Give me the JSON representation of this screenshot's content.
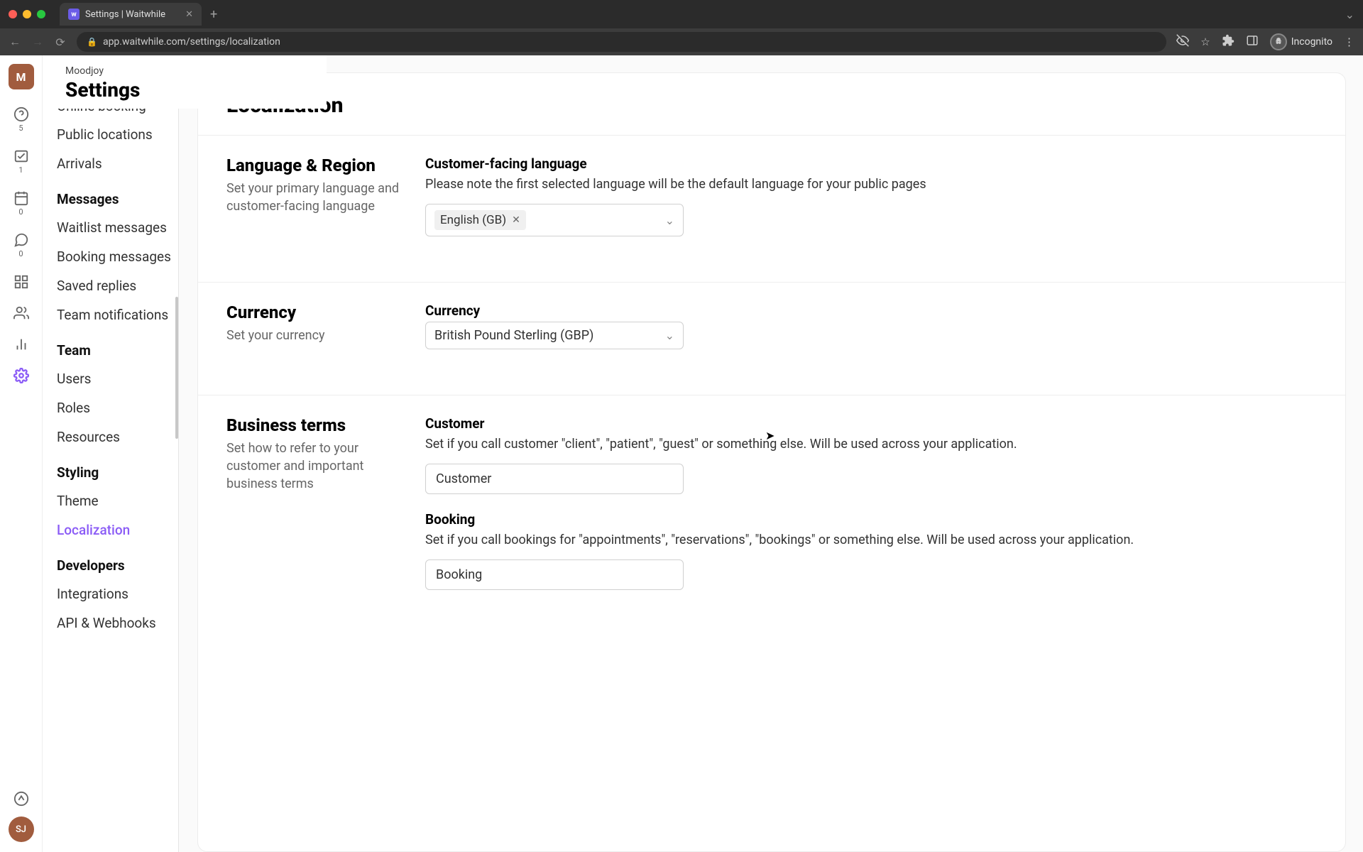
{
  "browser": {
    "tab_title": "Settings | Waitwhile",
    "url": "app.waitwhile.com/settings/localization",
    "incognito_label": "Incognito"
  },
  "rail": {
    "logo_letter": "M",
    "badges": {
      "help": "5",
      "inbox": "1",
      "calendar": "0",
      "chat": "0"
    },
    "avatar_initials": "SJ"
  },
  "header": {
    "breadcrumb": "Moodjoy",
    "title": "Settings"
  },
  "sidebar": {
    "cut_item": "Online booking",
    "items_top": [
      "Public locations",
      "Arrivals"
    ],
    "group_messages": "Messages",
    "items_messages": [
      "Waitlist messages",
      "Booking messages",
      "Saved replies",
      "Team notifications"
    ],
    "group_team": "Team",
    "items_team": [
      "Users",
      "Roles",
      "Resources"
    ],
    "group_styling": "Styling",
    "items_styling": [
      "Theme",
      "Localization"
    ],
    "group_developers": "Developers",
    "items_developers": [
      "Integrations",
      "API & Webhooks"
    ]
  },
  "main": {
    "title": "Localization",
    "language": {
      "section_title": "Language & Region",
      "section_desc": "Set your primary language and customer-facing language",
      "field_label": "Customer-facing language",
      "field_desc": "Please note the first selected language will be the default language for your public pages",
      "chip_value": "English (GB)"
    },
    "currency": {
      "section_title": "Currency",
      "section_desc": "Set your currency",
      "field_label": "Currency",
      "select_value": "British Pound Sterling (GBP)"
    },
    "terms": {
      "section_title": "Business terms",
      "section_desc": "Set how to refer to your customer and important business terms",
      "customer_label": "Customer",
      "customer_desc": "Set if you call customer \"client\", \"patient\", \"guest\" or something else. Will be used across your application.",
      "customer_value": "Customer",
      "booking_label": "Booking",
      "booking_desc": "Set if you call bookings for \"appointments\", \"reservations\", \"bookings\" or something else. Will be used across your application.",
      "booking_value": "Booking"
    }
  }
}
